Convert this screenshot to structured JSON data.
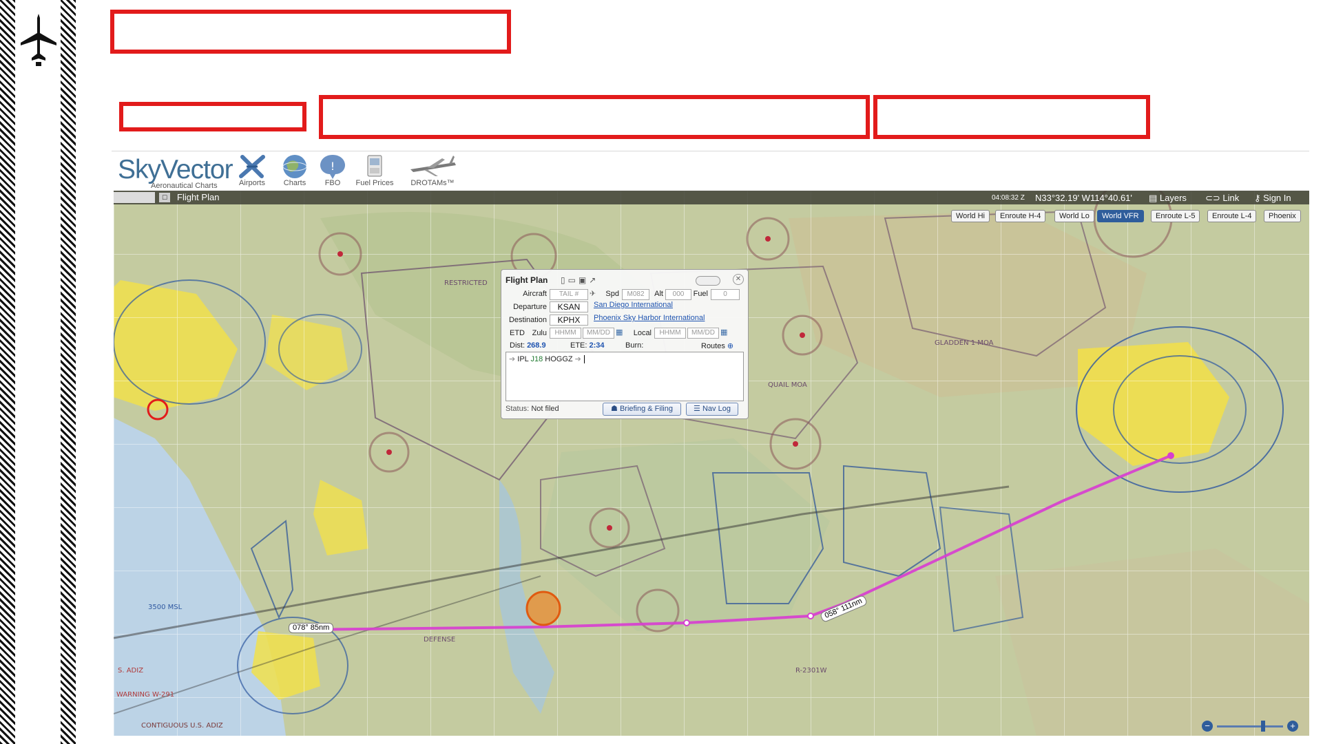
{
  "header": {
    "brand": "SkyVector",
    "tagline": "Aeronautical Charts",
    "nav": [
      {
        "label": "Airports",
        "icon": "airports-icon"
      },
      {
        "label": "Charts",
        "icon": "charts-icon"
      },
      {
        "label": "FBO",
        "icon": "fbo-icon"
      },
      {
        "label": "Fuel Prices",
        "icon": "fuel-prices-icon"
      },
      {
        "label": "DROTAMs™",
        "icon": "drotams-icon"
      }
    ]
  },
  "topbar": {
    "flight_plan_label": "Flight Plan",
    "zulu_time": "04:08:32 Z",
    "coordinates": "N33°32.19' W114°40.61'",
    "layers": "Layers",
    "link": "Link",
    "sign_in": "Sign In"
  },
  "chart_tabs": [
    {
      "label": "World Hi",
      "active": false
    },
    {
      "label": "Enroute H-4",
      "active": false
    },
    {
      "label": "World Lo",
      "active": false
    },
    {
      "label": "World VFR",
      "active": true
    },
    {
      "label": "Enroute L-5",
      "active": false
    },
    {
      "label": "Enroute L-4",
      "active": false
    },
    {
      "label": "Phoenix",
      "active": false
    }
  ],
  "flight_plan": {
    "title": "Flight Plan",
    "aircraft_label": "Aircraft",
    "aircraft_placeholder": "TAIL #",
    "speed_label": "Spd",
    "speed_placeholder": "M082",
    "altitude_label": "Alt",
    "altitude_placeholder": "000",
    "fuel_label": "Fuel",
    "fuel_placeholder": "0",
    "departure_label": "Departure",
    "departure_code": "KSAN",
    "departure_name": "San Diego International",
    "destination_label": "Destination",
    "destination_code": "KPHX",
    "destination_name": "Phoenix Sky Harbor International",
    "etd_label": "ETD",
    "zulu_label": "Zulu",
    "local_label": "Local",
    "time_placeholder": "HHMM",
    "date_placeholder": "MM/DD",
    "dist_label": "Dist:",
    "dist_value": "268.9",
    "ete_label": "ETE:",
    "ete_value": "2:34",
    "burn_label": "Burn:",
    "routes_label": "Routes",
    "route_fixes": [
      "IPL",
      "J18",
      "HOGGZ"
    ],
    "status_label": "Status:",
    "status_value": "Not filed",
    "briefing_button": "Briefing & Filing",
    "navlog_button": "Nav Log"
  },
  "route_legs": [
    {
      "label": "078° 85nm"
    },
    {
      "label": "058° 111nm"
    }
  ],
  "map_labels": {
    "restricted": "RESTRICTED",
    "gladden": "GLADDEN 1 MOA",
    "quail": "QUAIL MOA",
    "defense": "DEFENSE",
    "adiz": "S. ADIZ",
    "warning": "WARNING W-291",
    "contiguous": "CONTIGUOUS U.S. ADIZ",
    "r2301w": "R-2301W",
    "alt_3500": "3500 MSL"
  },
  "colors": {
    "route": "#d73fd0",
    "red_box": "#e21b1b",
    "active_tab": "#2f5d9b"
  }
}
